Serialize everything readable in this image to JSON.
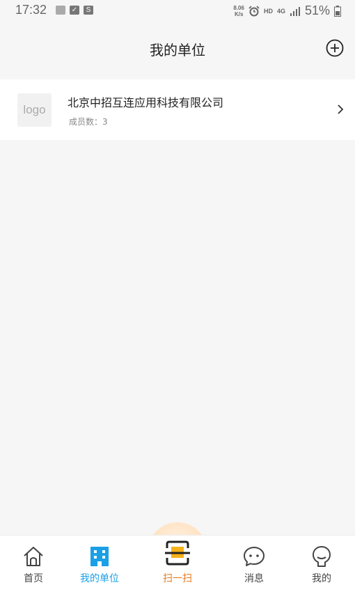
{
  "status_bar": {
    "time": "17:32",
    "network_speed_value": "8.06",
    "network_speed_unit": "K/s",
    "hd_label": "HD",
    "network_type": "4G",
    "battery": "51%",
    "icons": [
      "image-icon",
      "check-icon",
      "s-app-icon",
      "alarm-icon",
      "signal-icon",
      "battery-icon"
    ]
  },
  "header": {
    "title": "我的单位",
    "add_icon": "plus-circle-icon"
  },
  "company": {
    "logo_text": "logo",
    "name": "北京中招互连应用科技有限公司",
    "members_label": "成员数：3"
  },
  "tabbar": {
    "tabs": [
      {
        "label": "首页",
        "icon": "home-icon"
      },
      {
        "label": "我的单位",
        "icon": "building-icon",
        "active": true
      },
      {
        "label": "扫一扫",
        "icon": "scan-icon"
      },
      {
        "label": "消息",
        "icon": "chat-icon"
      },
      {
        "label": "我的",
        "icon": "profile-icon"
      }
    ]
  },
  "colors": {
    "background": "#f6f6f6",
    "active_tab": "#1aa0e6",
    "scan_accent": "#e87a1e",
    "scan_yellow": "#f5b21a"
  }
}
